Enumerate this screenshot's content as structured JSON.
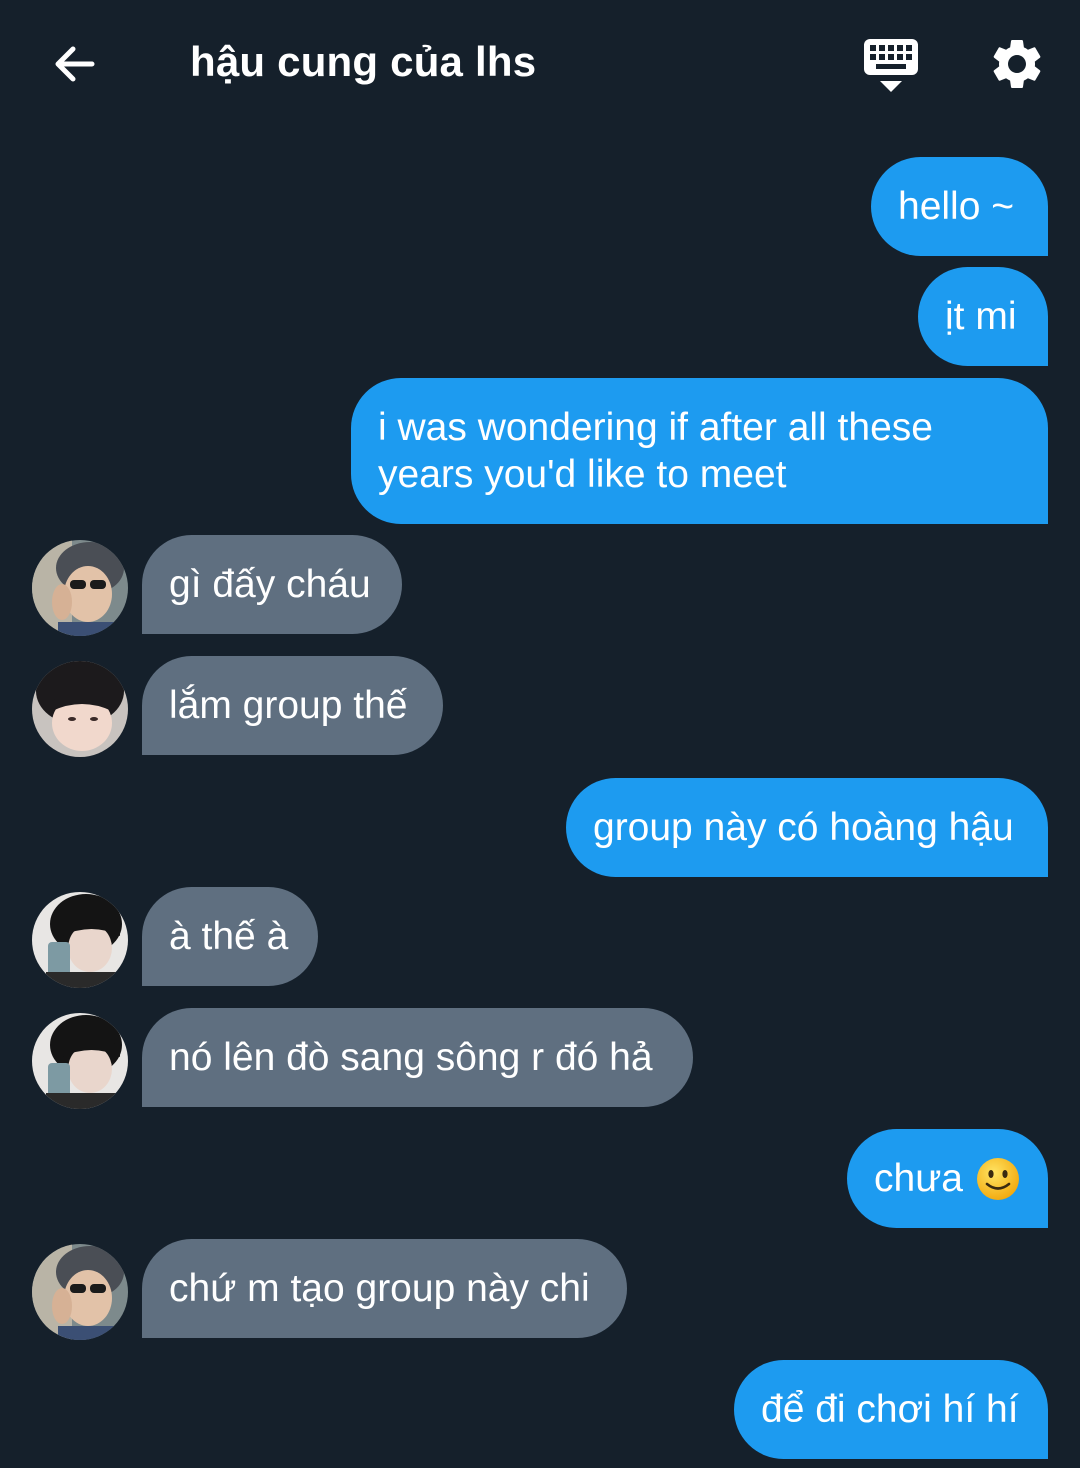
{
  "header": {
    "title": "hậu cung của lhs",
    "back_icon": "arrow-left-icon",
    "keyboard_icon": "keyboard-icon",
    "settings_icon": "gear-icon"
  },
  "colors": {
    "background": "#15202b",
    "outgoing_bubble": "#1d9bf0",
    "incoming_bubble": "#5f6f80",
    "text": "#ffffff"
  },
  "messages": [
    {
      "direction": "out",
      "text": "hello ~"
    },
    {
      "direction": "out",
      "text": "ịt mi"
    },
    {
      "direction": "out",
      "lines": [
        "i was wondering if after all these",
        "years you'd like to meet"
      ]
    },
    {
      "direction": "in",
      "avatar": "user-a",
      "text": "gì đấy cháu"
    },
    {
      "direction": "in",
      "avatar": "user-b",
      "text": "lắm group thế"
    },
    {
      "direction": "out",
      "text": "group này có hoàng hậu"
    },
    {
      "direction": "in",
      "avatar": "user-c",
      "text": "à thế à"
    },
    {
      "direction": "in",
      "avatar": "user-c",
      "text": "nó lên đò sang sông r đó hả"
    },
    {
      "direction": "out",
      "text": "chưa",
      "emoji": "slightly-smiling-face-emoji"
    },
    {
      "direction": "in",
      "avatar": "user-a",
      "text": "chứ m tạo group này chi"
    },
    {
      "direction": "out",
      "text": "để đi chơi hí hí"
    }
  ]
}
